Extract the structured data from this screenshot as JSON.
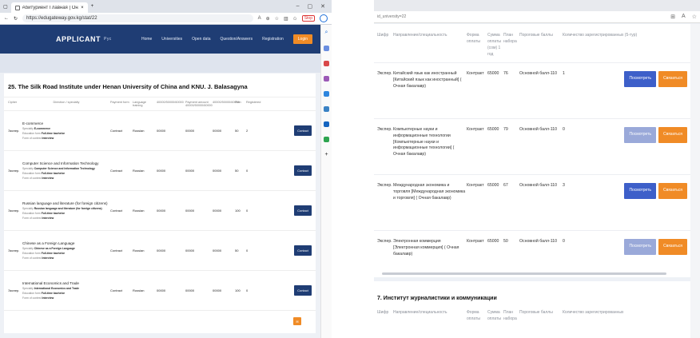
{
  "left": {
    "tab_title": "Абитуриент Главная | Онлайн",
    "url": "https://edugateway.gov.kg/stat/22",
    "ext_label": "Stop",
    "logo": "APPLICANT",
    "logo_sub": "Рус",
    "nav": [
      "Home",
      "Universities",
      "Open data",
      "Question/Answers",
      "Registration"
    ],
    "login": "Login",
    "university_title": "25. The Silk Road Institute under Henan University of China and KNU. J. Balasagyna",
    "headers": [
      "Cipher",
      "Direction / specialty",
      "Payment form",
      "Language training",
      "40000/50000/60000",
      "Payment amount 40000/50000/60000",
      "40000/50000/60000",
      "Plan",
      "Registered",
      ""
    ],
    "rows": [
      {
        "cipher": "Экспер.",
        "name": "E-commerce",
        "specialty": "E-commerce",
        "form": "Full-time bachelor",
        "exam": "Interview",
        "payment": "Contract",
        "lang": "Russian",
        "a": "00000",
        "b": "00000",
        "c": "00000",
        "plan": "50",
        "reg": "2",
        "btn": "Contact"
      },
      {
        "cipher": "Экспер.",
        "name": "Computer Science and Information Technology",
        "specialty": "Computer Science and Information Technology",
        "form": "Full-time bachelor",
        "exam": "Interview",
        "payment": "Contract",
        "lang": "Russian",
        "a": "00000",
        "b": "00000",
        "c": "00000",
        "plan": "50",
        "reg": "0",
        "btn": "Contact"
      },
      {
        "cipher": "Экспер.",
        "name": "Russian language and literature (for foreign citizens)",
        "specialty": "Russian language and literature (for foreign citizens)",
        "form": "Full-time bachelor",
        "exam": "Interview",
        "payment": "Contract",
        "lang": "Russian",
        "a": "00000",
        "b": "00000",
        "c": "00000",
        "plan": "100",
        "reg": "0",
        "btn": "Contact"
      },
      {
        "cipher": "Экспер.",
        "name": "Chinese as a Foreign Language",
        "specialty": "Chinese as a Foreign Language",
        "form": "Full-time bachelor",
        "exam": "Interview",
        "payment": "Contract",
        "lang": "Russian",
        "a": "00000",
        "b": "00000",
        "c": "00000",
        "plan": "50",
        "reg": "0",
        "btn": "Contact"
      },
      {
        "cipher": "Экспер.",
        "name": "International Economics and Trade",
        "specialty": "International Economics and Trade",
        "form": "Full-time bachelor",
        "exam": "Interview",
        "payment": "Contract",
        "lang": "Russian",
        "a": "00000",
        "b": "00000",
        "c": "00000",
        "plan": "100",
        "reg": "0",
        "btn": "Contact"
      }
    ],
    "labels": {
      "specialty": "Specialty",
      "form": "Education form",
      "exam": "Form of contest"
    }
  },
  "right": {
    "url": "id_university=22",
    "headers": [
      "Шифр",
      "Направление/специальность",
      "Форма оплаты",
      "Сумма оплаты (сом) 1 год",
      "План набора",
      "Пороговые баллы",
      "Количество зарегистрированных (5-тур)"
    ],
    "rows": [
      {
        "cipher": "Экспер.",
        "name": "Китайский язык как иностранный [Китайский язык как иностранный] ( Очная бакалавр)",
        "payment": "Контракт",
        "sum": "65000",
        "plan": "76",
        "threshold": "Основной балл-110",
        "reg": "1",
        "view": "Посмотреть",
        "contact": "Связаться",
        "faded": false
      },
      {
        "cipher": "Экспер.",
        "name": "Компьютерные науки и информационные технологии [Компьютерные науки и информационные технологии] ( Очная бакалавр)",
        "payment": "Контракт",
        "sum": "65000",
        "plan": "79",
        "threshold": "Основной балл-110",
        "reg": "0",
        "view": "Посмотреть",
        "contact": "Связаться",
        "faded": true
      },
      {
        "cipher": "Экспер.",
        "name": "Международная экономика и торговля [Международная экономика и торговля] ( Очная бакалавр)",
        "payment": "Контракт",
        "sum": "65000",
        "plan": "67",
        "threshold": "Основной балл-110",
        "reg": "3",
        "view": "Посмотреть",
        "contact": "Связаться",
        "faded": false
      },
      {
        "cipher": "Экспер.",
        "name": "Электронная коммерция [Электронная коммерция] ( Очная бакалавр)",
        "payment": "Контракт",
        "sum": "65000",
        "plan": "50",
        "threshold": "Основной балл-110",
        "reg": "0",
        "view": "Посмотреть",
        "contact": "Связаться",
        "faded": true
      }
    ],
    "section2_title": "7. Институт журналистики и коммуникации",
    "headers2": [
      "Шифр",
      "Направление/специальность",
      "Форма оплаты",
      "Сумма оплаты",
      "План набора",
      "Пороговые баллы",
      "Количество зарегистрированных"
    ]
  }
}
